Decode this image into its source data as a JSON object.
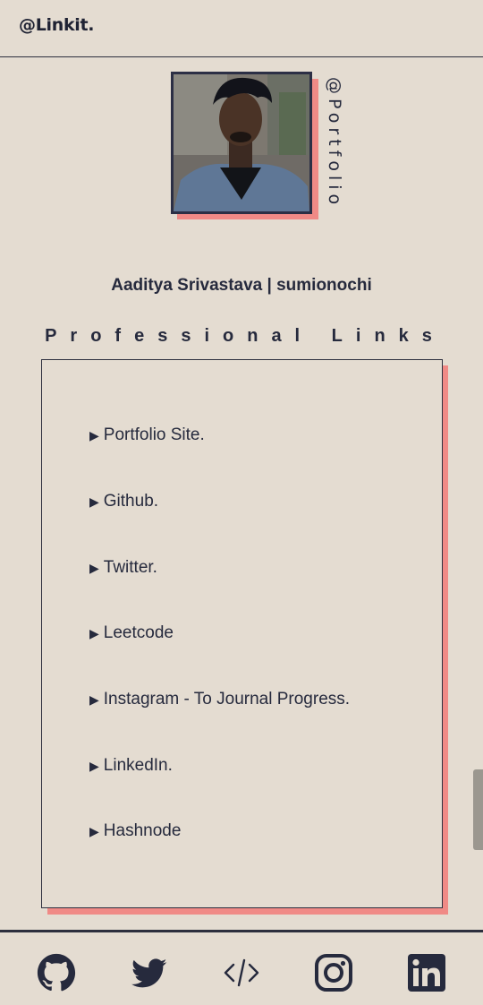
{
  "header": {
    "brand": "@Linkit."
  },
  "profile": {
    "vertical_handle": "@Portfolio",
    "name_line": "Aaditya Srivastava | sumionochi"
  },
  "links_section": {
    "title": "Professional Links",
    "items": [
      {
        "label": "Portfolio Site."
      },
      {
        "label": "Github."
      },
      {
        "label": "Twitter."
      },
      {
        "label": "Leetcode"
      },
      {
        "label": "Instagram - To Journal Progress."
      },
      {
        "label": "LinkedIn."
      },
      {
        "label": "Hashnode"
      }
    ]
  },
  "footer": {
    "icons": [
      "github-icon",
      "twitter-icon",
      "code-icon",
      "instagram-icon",
      "linkedin-icon"
    ]
  },
  "colors": {
    "background": "#e4dcd1",
    "ink": "#262a3d",
    "accent_shadow": "#f08a86"
  }
}
